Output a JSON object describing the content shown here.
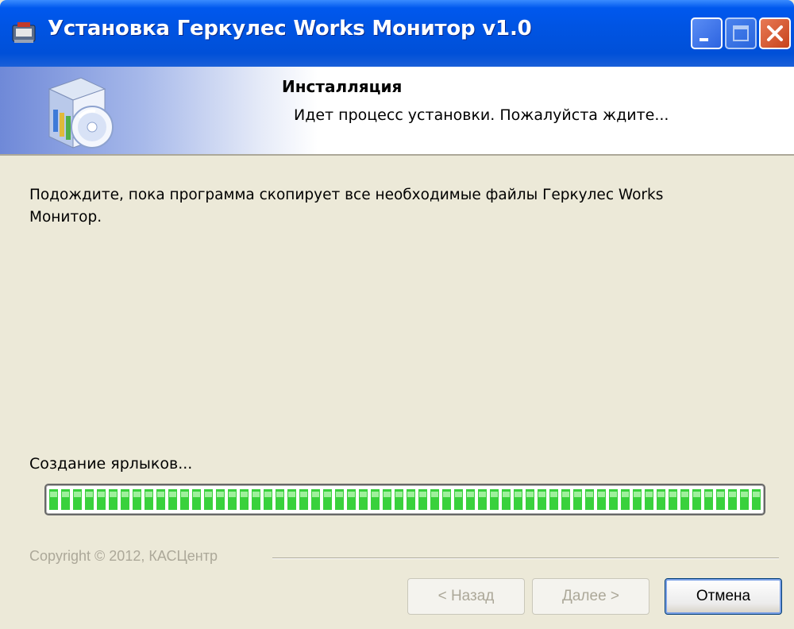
{
  "window": {
    "title": "Установка Геркулес Works Монитор v1.0",
    "controls": [
      "minimize-icon",
      "maximize-icon",
      "close-icon"
    ]
  },
  "banner": {
    "title": "Инсталляция",
    "subtitle": "Идет процесс установки. Пожалуйста ждите...",
    "icon": "installer-box-cd-icon"
  },
  "body": {
    "message": "Подождите, пока программа скопирует все необходимые файлы Геркулес Works Монитор.",
    "status": "Создание ярлыков...",
    "progress": 1.0
  },
  "footer": {
    "copyright": "Copyright © 2012, КАСЦентр"
  },
  "buttons": {
    "back": "< Назад",
    "next": "Далее >",
    "cancel": "Отмена"
  },
  "colors": {
    "titlebar": "#0054e3",
    "progress_green": "#39d13c",
    "face": "#ece9d8"
  }
}
